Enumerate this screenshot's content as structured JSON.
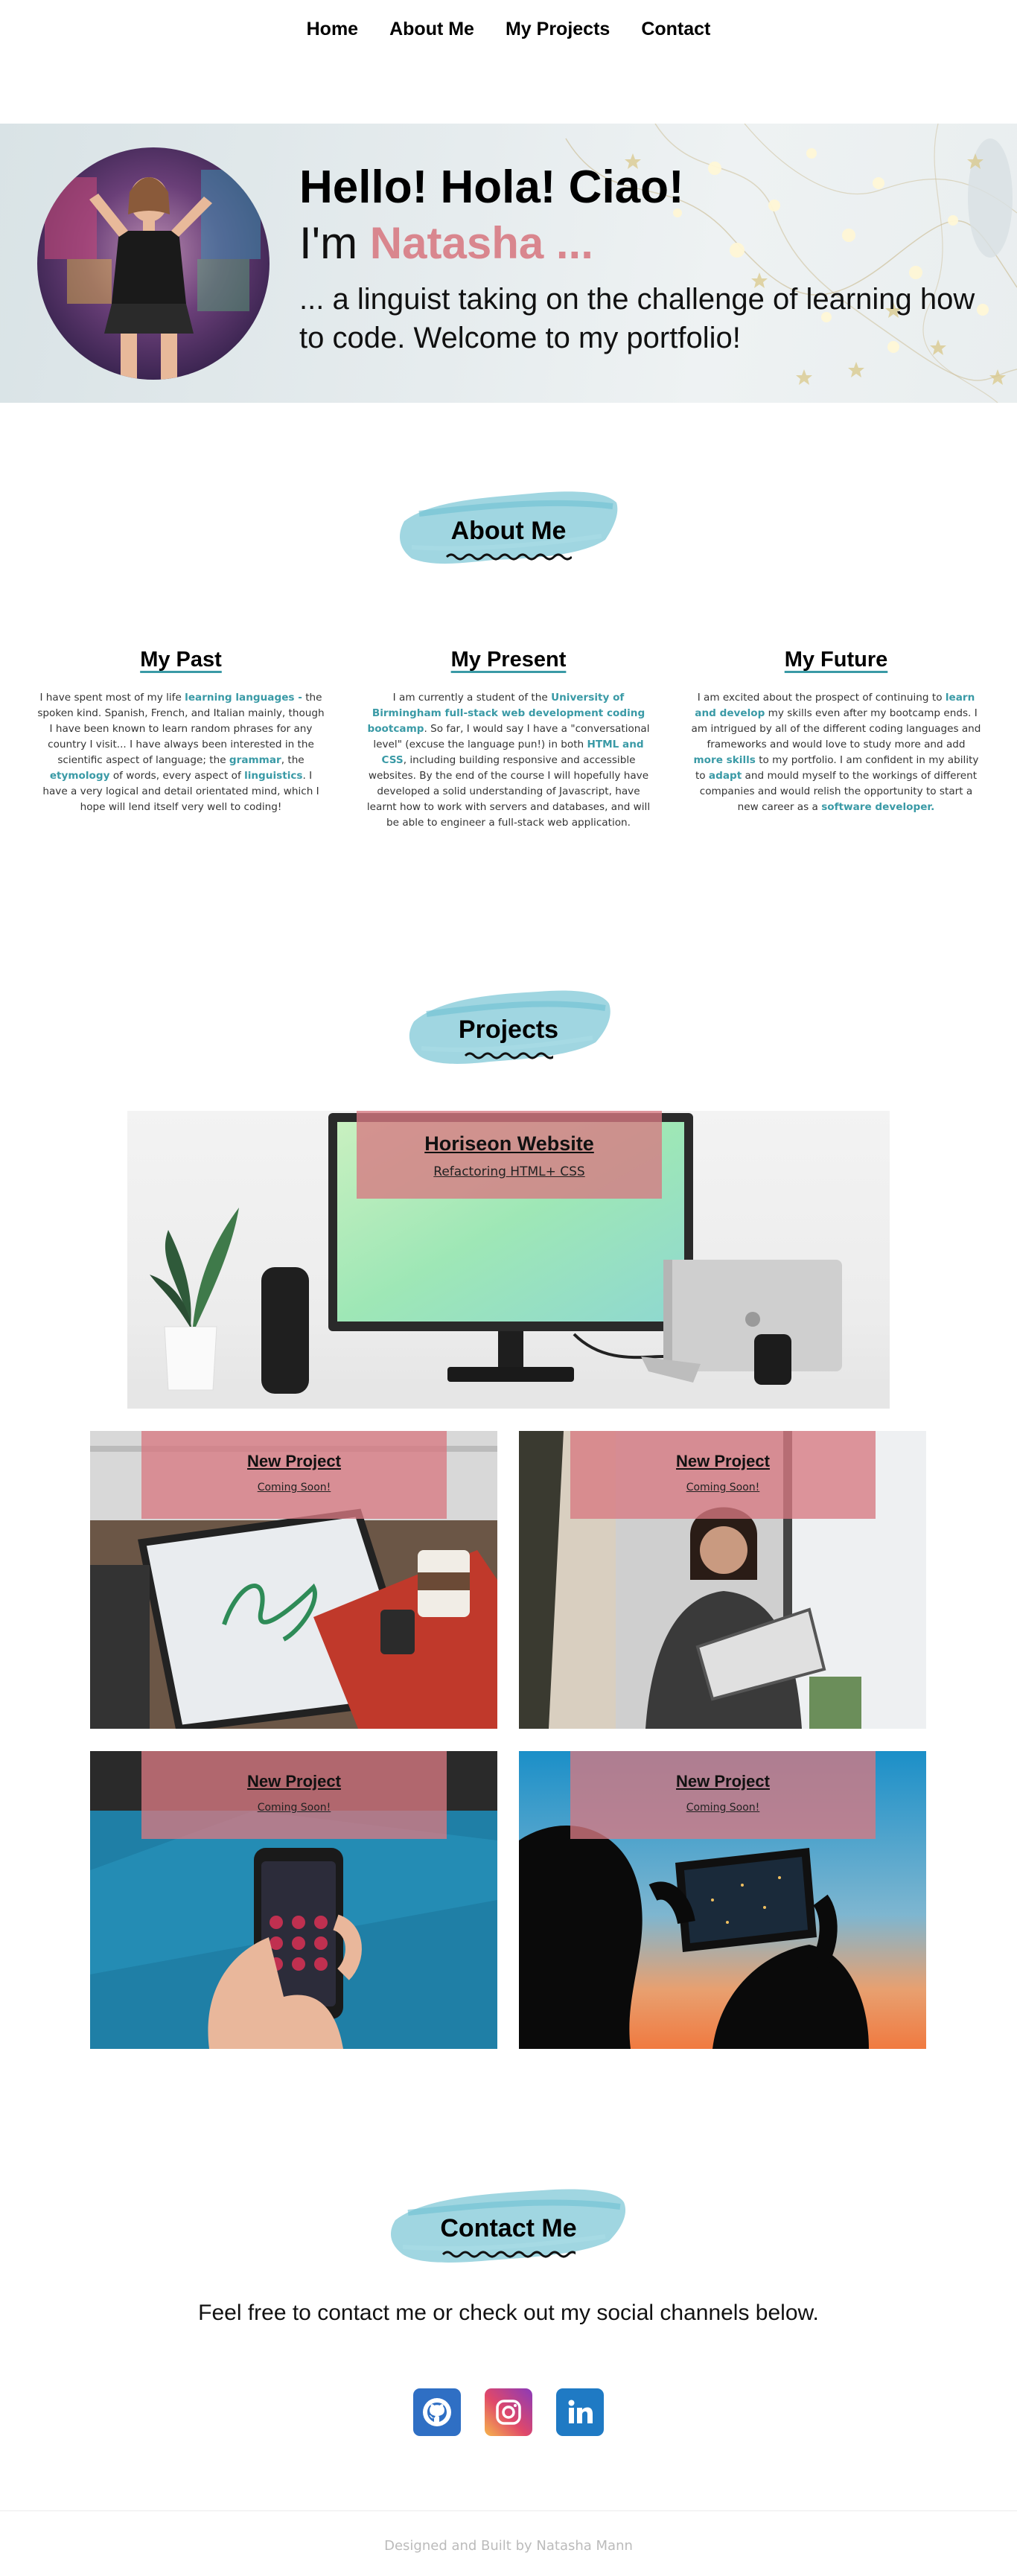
{
  "nav": {
    "items": [
      "Home",
      "About Me",
      "My Projects",
      "Contact"
    ]
  },
  "hero": {
    "greeting": "Hello! Hola! Ciao!",
    "im_prefix": "I'm ",
    "name": "Natasha ...",
    "description": "... a linguist taking on the challenge of learning how to code. Welcome to my portfolio!"
  },
  "about": {
    "title": "About Me",
    "columns": [
      {
        "heading": "My Past",
        "parts": [
          {
            "t": "I have spent most of my life "
          },
          {
            "t": "learning languages -",
            "hl": true
          },
          {
            "t": " the spoken kind. Spanish, French, and Italian mainly, though I have been known to learn random phrases for any country I visit... I have always been interested in the scientific aspect of language; the "
          },
          {
            "t": "grammar",
            "hl": true
          },
          {
            "t": ", the "
          },
          {
            "t": "etymology",
            "hl": true
          },
          {
            "t": " of words, every aspect of "
          },
          {
            "t": "linguistics",
            "hl": true
          },
          {
            "t": ". I have a very logical and detail orientated mind, which I hope will lend itself very well to coding!"
          }
        ]
      },
      {
        "heading": "My Present",
        "parts": [
          {
            "t": "I am currently a student of the "
          },
          {
            "t": "University of Birmingham full-stack web development coding bootcamp",
            "hl": true
          },
          {
            "t": ". So far, I would say I have a \"conversational level\" (excuse the language pun!) in both "
          },
          {
            "t": "HTML and CSS",
            "hl": true
          },
          {
            "t": ", including building responsive and accessible websites. By the end of the course I will hopefully have developed a solid understanding of Javascript, have learnt how to work with servers and databases, and will be able to engineer a full-stack web application."
          }
        ]
      },
      {
        "heading": "My Future",
        "parts": [
          {
            "t": "I am excited about the prospect of continuing to "
          },
          {
            "t": "learn and develop",
            "hl": true
          },
          {
            "t": " my skills even after my bootcamp ends. I am intrigued by all of the different coding languages and frameworks and would love to study more and add "
          },
          {
            "t": "more skills",
            "hl": true
          },
          {
            "t": " to my portfolio. I am confident in my ability to "
          },
          {
            "t": "adapt",
            "hl": true
          },
          {
            "t": " and mould myself to the workings of different companies and would relish the opportunity to start a new career as a "
          },
          {
            "t": "software developer.",
            "hl": true
          }
        ]
      }
    ]
  },
  "projects": {
    "title": "Projects",
    "featured": {
      "title": "Horiseon Website",
      "subtitle": "Refactoring HTML+ CSS"
    },
    "cards": [
      {
        "title": "New Project",
        "subtitle": "Coming Soon!"
      },
      {
        "title": "New Project",
        "subtitle": "Coming Soon!"
      },
      {
        "title": "New Project",
        "subtitle": "Coming Soon!"
      },
      {
        "title": "New Project",
        "subtitle": "Coming Soon!"
      }
    ]
  },
  "contact": {
    "title": "Contact Me",
    "text": "Feel free to contact me or check out my social channels below.",
    "socials": [
      "github-icon",
      "instagram-icon",
      "linkedin-icon"
    ]
  },
  "footer": {
    "text": "Designed and Built by Natasha Mann"
  },
  "colors": {
    "accent_teal": "#3a9aa6",
    "brush_blue": "#8fcfdc",
    "overlay_pink": "#d9868e",
    "name_pink": "#d9868e"
  }
}
